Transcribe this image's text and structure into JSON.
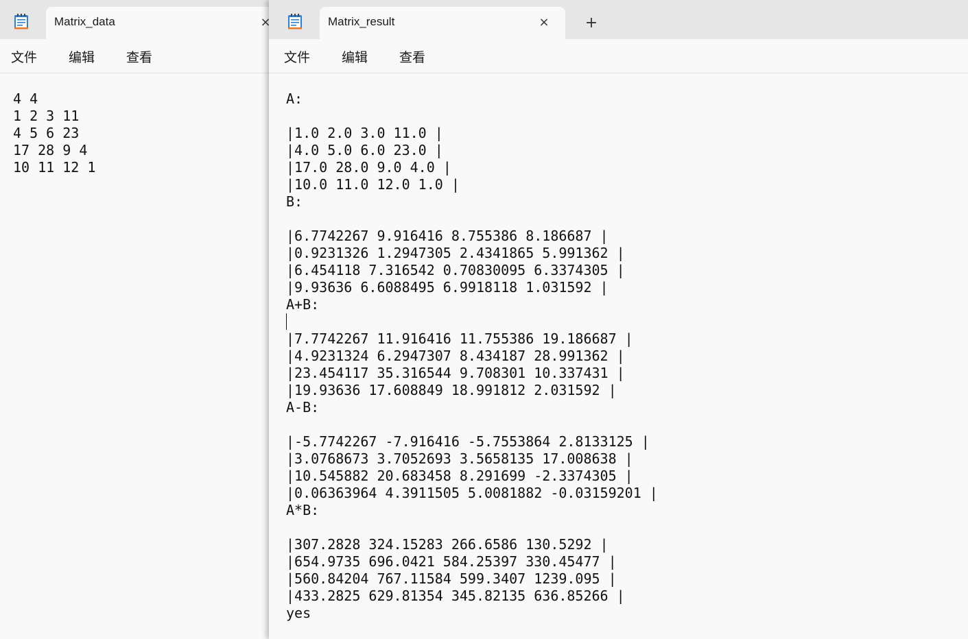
{
  "left_window": {
    "tab_title": "Matrix_data",
    "tab_close_partial": "×",
    "menu": [
      "文件",
      "编辑",
      "查看"
    ],
    "lines": [
      "4 4",
      "1 2 3 11",
      "4 5 6 23",
      "17 28 9 4",
      "10 11 12 1"
    ]
  },
  "right_window": {
    "tab_title": "Matrix_result",
    "tab_close": "×",
    "new_tab": "+",
    "menu": [
      "文件",
      "编辑",
      "查看"
    ],
    "lines": [
      "A:",
      "",
      "|1.0 2.0 3.0 11.0 |",
      "|4.0 5.0 6.0 23.0 |",
      "|17.0 28.0 9.0 4.0 |",
      "|10.0 11.0 12.0 1.0 |",
      "B:",
      "",
      "|6.7742267 9.916416 8.755386 8.186687 |",
      "|0.9231326 1.2947305 2.4341865 5.991362 |",
      "|6.454118 7.316542 0.70830095 6.3374305 |",
      "|9.93636 6.6088495 6.9918118 1.031592 |",
      "A+B:",
      "",
      "|7.7742267 11.916416 11.755386 19.186687 |",
      "|4.9231324 6.2947307 8.434187 28.991362 |",
      "|23.454117 35.316544 9.708301 10.337431 |",
      "|19.93636 17.608849 18.991812 2.031592 |",
      "A-B:",
      "",
      "|-5.7742267 -7.916416 -5.7553864 2.8133125 |",
      "|3.0768673 3.7052693 3.5658135 17.008638 |",
      "|10.545882 20.683458 8.291699 -2.3374305 |",
      "|0.06363964 4.3911505 5.0081882 -0.03159201 |",
      "A*B:",
      "",
      "|307.2828 324.15283 266.6586 130.5292 |",
      "|654.9735 696.0421 584.25397 330.45477 |",
      "|560.84204 767.11584 599.3407 1239.095 |",
      "|433.2825 629.81354 345.82135 636.85266 |",
      "yes"
    ]
  },
  "colors": {
    "titlebar": "#e6e6e6",
    "editor_bg": "#f9f9f9",
    "notepad_icon_blue": "#2f7fd4",
    "notepad_icon_orange": "#e8782a"
  },
  "icons": {
    "app": "notepad-icon",
    "close": "close-icon",
    "new_tab": "plus-icon"
  }
}
